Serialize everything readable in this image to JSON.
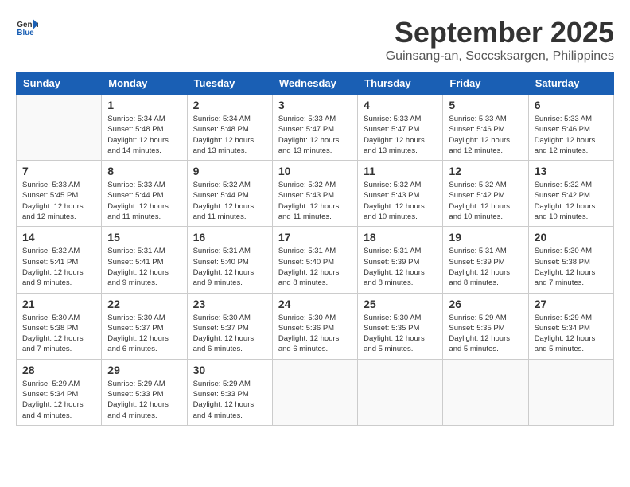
{
  "logo": {
    "text_general": "General",
    "text_blue": "Blue"
  },
  "title": {
    "month": "September 2025",
    "location": "Guinsang-an, Soccsksargen, Philippines"
  },
  "weekdays": [
    "Sunday",
    "Monday",
    "Tuesday",
    "Wednesday",
    "Thursday",
    "Friday",
    "Saturday"
  ],
  "weeks": [
    [
      {
        "day": "",
        "info": ""
      },
      {
        "day": "1",
        "info": "Sunrise: 5:34 AM\nSunset: 5:48 PM\nDaylight: 12 hours\nand 14 minutes."
      },
      {
        "day": "2",
        "info": "Sunrise: 5:34 AM\nSunset: 5:48 PM\nDaylight: 12 hours\nand 13 minutes."
      },
      {
        "day": "3",
        "info": "Sunrise: 5:33 AM\nSunset: 5:47 PM\nDaylight: 12 hours\nand 13 minutes."
      },
      {
        "day": "4",
        "info": "Sunrise: 5:33 AM\nSunset: 5:47 PM\nDaylight: 12 hours\nand 13 minutes."
      },
      {
        "day": "5",
        "info": "Sunrise: 5:33 AM\nSunset: 5:46 PM\nDaylight: 12 hours\nand 12 minutes."
      },
      {
        "day": "6",
        "info": "Sunrise: 5:33 AM\nSunset: 5:46 PM\nDaylight: 12 hours\nand 12 minutes."
      }
    ],
    [
      {
        "day": "7",
        "info": "Sunrise: 5:33 AM\nSunset: 5:45 PM\nDaylight: 12 hours\nand 12 minutes."
      },
      {
        "day": "8",
        "info": "Sunrise: 5:33 AM\nSunset: 5:44 PM\nDaylight: 12 hours\nand 11 minutes."
      },
      {
        "day": "9",
        "info": "Sunrise: 5:32 AM\nSunset: 5:44 PM\nDaylight: 12 hours\nand 11 minutes."
      },
      {
        "day": "10",
        "info": "Sunrise: 5:32 AM\nSunset: 5:43 PM\nDaylight: 12 hours\nand 11 minutes."
      },
      {
        "day": "11",
        "info": "Sunrise: 5:32 AM\nSunset: 5:43 PM\nDaylight: 12 hours\nand 10 minutes."
      },
      {
        "day": "12",
        "info": "Sunrise: 5:32 AM\nSunset: 5:42 PM\nDaylight: 12 hours\nand 10 minutes."
      },
      {
        "day": "13",
        "info": "Sunrise: 5:32 AM\nSunset: 5:42 PM\nDaylight: 12 hours\nand 10 minutes."
      }
    ],
    [
      {
        "day": "14",
        "info": "Sunrise: 5:32 AM\nSunset: 5:41 PM\nDaylight: 12 hours\nand 9 minutes."
      },
      {
        "day": "15",
        "info": "Sunrise: 5:31 AM\nSunset: 5:41 PM\nDaylight: 12 hours\nand 9 minutes."
      },
      {
        "day": "16",
        "info": "Sunrise: 5:31 AM\nSunset: 5:40 PM\nDaylight: 12 hours\nand 9 minutes."
      },
      {
        "day": "17",
        "info": "Sunrise: 5:31 AM\nSunset: 5:40 PM\nDaylight: 12 hours\nand 8 minutes."
      },
      {
        "day": "18",
        "info": "Sunrise: 5:31 AM\nSunset: 5:39 PM\nDaylight: 12 hours\nand 8 minutes."
      },
      {
        "day": "19",
        "info": "Sunrise: 5:31 AM\nSunset: 5:39 PM\nDaylight: 12 hours\nand 8 minutes."
      },
      {
        "day": "20",
        "info": "Sunrise: 5:30 AM\nSunset: 5:38 PM\nDaylight: 12 hours\nand 7 minutes."
      }
    ],
    [
      {
        "day": "21",
        "info": "Sunrise: 5:30 AM\nSunset: 5:38 PM\nDaylight: 12 hours\nand 7 minutes."
      },
      {
        "day": "22",
        "info": "Sunrise: 5:30 AM\nSunset: 5:37 PM\nDaylight: 12 hours\nand 6 minutes."
      },
      {
        "day": "23",
        "info": "Sunrise: 5:30 AM\nSunset: 5:37 PM\nDaylight: 12 hours\nand 6 minutes."
      },
      {
        "day": "24",
        "info": "Sunrise: 5:30 AM\nSunset: 5:36 PM\nDaylight: 12 hours\nand 6 minutes."
      },
      {
        "day": "25",
        "info": "Sunrise: 5:30 AM\nSunset: 5:35 PM\nDaylight: 12 hours\nand 5 minutes."
      },
      {
        "day": "26",
        "info": "Sunrise: 5:29 AM\nSunset: 5:35 PM\nDaylight: 12 hours\nand 5 minutes."
      },
      {
        "day": "27",
        "info": "Sunrise: 5:29 AM\nSunset: 5:34 PM\nDaylight: 12 hours\nand 5 minutes."
      }
    ],
    [
      {
        "day": "28",
        "info": "Sunrise: 5:29 AM\nSunset: 5:34 PM\nDaylight: 12 hours\nand 4 minutes."
      },
      {
        "day": "29",
        "info": "Sunrise: 5:29 AM\nSunset: 5:33 PM\nDaylight: 12 hours\nand 4 minutes."
      },
      {
        "day": "30",
        "info": "Sunrise: 5:29 AM\nSunset: 5:33 PM\nDaylight: 12 hours\nand 4 minutes."
      },
      {
        "day": "",
        "info": ""
      },
      {
        "day": "",
        "info": ""
      },
      {
        "day": "",
        "info": ""
      },
      {
        "day": "",
        "info": ""
      }
    ]
  ]
}
